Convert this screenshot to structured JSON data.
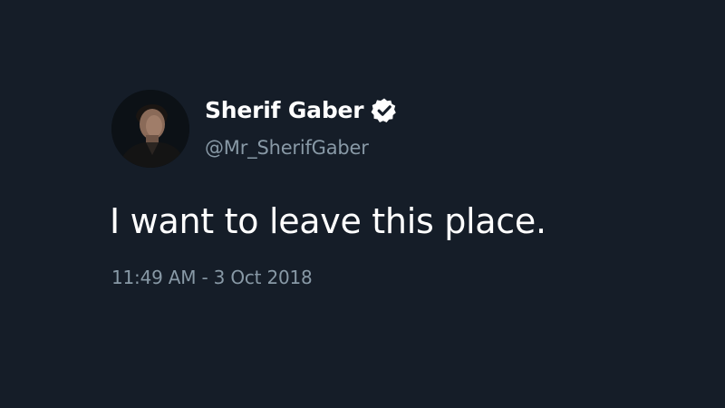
{
  "tweet": {
    "author": {
      "display_name": "Sherif Gaber",
      "handle": "@Mr_SherifGaber",
      "verified": true,
      "avatar_icon": "profile-photo"
    },
    "text": "I want to leave this place.",
    "timestamp": "11:49 AM - 3 Oct 2018"
  },
  "colors": {
    "background": "#151d28",
    "primary_text": "#ffffff",
    "secondary_text": "#8899a6"
  }
}
